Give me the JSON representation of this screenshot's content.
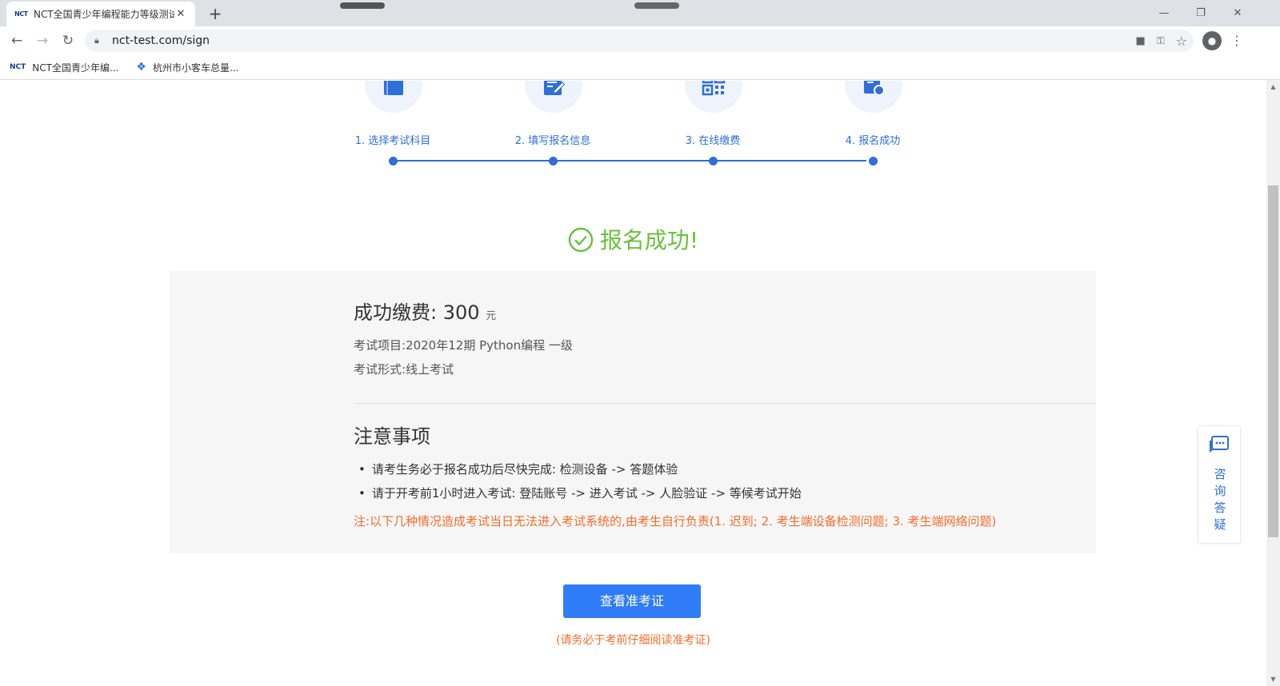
{
  "browser": {
    "tab_title": "NCT全国青少年编程能力等级测试",
    "tab_favicon": "NCT",
    "new_tab": "+",
    "url": "nct-test.com/sign",
    "bookmarks": [
      {
        "icon": "NCT",
        "label": "NCT全国青少年编..."
      },
      {
        "icon": "❖",
        "label": "杭州市小客车总量..."
      }
    ]
  },
  "steps": [
    {
      "label": "1. 选择考试科目",
      "icon": "book-icon"
    },
    {
      "label": "2. 填写报名信息",
      "icon": "edit-form-icon"
    },
    {
      "label": "3. 在线缴费",
      "icon": "qr-code-icon"
    },
    {
      "label": "4. 报名成功",
      "icon": "doc-check-icon"
    }
  ],
  "success": {
    "title": "报名成功!"
  },
  "payment": {
    "label": "成功缴费:",
    "amount": "300",
    "unit": "元",
    "exam_item": "考试项目:2020年12期 Python编程 一级",
    "exam_form": "考试形式:线上考试"
  },
  "notice": {
    "title": "注意事项",
    "items": [
      "请考生务必于报名成功后尽快完成: 检测设备 -> 答题体验",
      "请于开考前1小时进入考试: 登陆账号 -> 进入考试 -> 人脸验证 -> 等候考试开始"
    ],
    "warning": "注:以下几种情况造成考试当日无法进入考试系统的,由考生自行负责(1. 迟到; 2. 考生端设备检测问题; 3. 考生端网络问题)"
  },
  "actions": {
    "view_ticket": "查看准考证",
    "view_ticket_note": "(请务必于考前仔细阅读准考证)"
  },
  "consult": {
    "label": "咨询答疑"
  },
  "colors": {
    "primary": "#2f6fd8",
    "success": "#67c23a",
    "warning": "#f56c2c",
    "button": "#2f7cf6"
  }
}
